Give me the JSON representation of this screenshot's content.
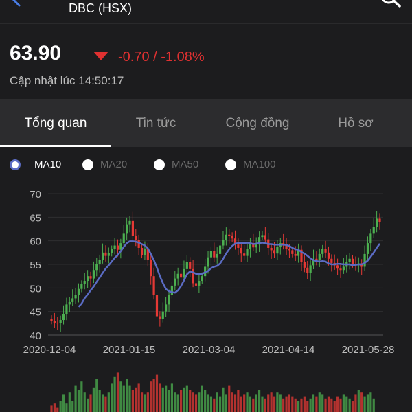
{
  "header": {
    "title": "DBC (HSX)",
    "back_icon": "back-chevron-icon",
    "search_icon": "search-icon"
  },
  "quote": {
    "price": "63.90",
    "change": "-0.70 / -1.08%",
    "updated": "Cập nhật lúc 14:50:17",
    "direction_icon": "triangle-down-icon",
    "down_color": "#e03131"
  },
  "tabs": [
    {
      "label": "Tổng quan",
      "active": true
    },
    {
      "label": "Tin tức",
      "active": false
    },
    {
      "label": "Cộng đồng",
      "active": false
    },
    {
      "label": "Hồ sơ",
      "active": false
    }
  ],
  "legend": [
    {
      "label": "MA10",
      "active": true,
      "color": "#5b6cc4"
    },
    {
      "label": "MA20",
      "active": false
    },
    {
      "label": "MA50",
      "active": false
    },
    {
      "label": "MA100",
      "active": false
    }
  ],
  "chart_data": {
    "type": "candlestick",
    "y_ticks": [
      40,
      45,
      50,
      55,
      60,
      65,
      70
    ],
    "ylim": [
      40,
      70
    ],
    "x_tick_labels": [
      "2020-12-04",
      "2021-01-15",
      "2021-03-04",
      "2021-04-14",
      "2021-05-28"
    ],
    "up_color": "#4caf50",
    "down_color": "#e53935",
    "ma_color": "#5b6cc4",
    "close": [
      43.0,
      42.6,
      42.5,
      43.2,
      44.5,
      46.5,
      47.0,
      47.8,
      48.5,
      49.8,
      50.8,
      51.5,
      52.5,
      52.0,
      53.8,
      55.0,
      56.0,
      57.5,
      56.8,
      57.4,
      58.2,
      59.0,
      58.1,
      59.5,
      61.5,
      63.5,
      64.2,
      61.0,
      60.1,
      58.5,
      57.0,
      58.2,
      56.0,
      52.5,
      48.5,
      44.0,
      43.5,
      45.0,
      46.5,
      48.5,
      50.5,
      52.0,
      53.0,
      52.2,
      54.0,
      55.5,
      54.0,
      51.0,
      50.5,
      51.5,
      52.5,
      54.5,
      56.5,
      57.8,
      56.5,
      57.2,
      59.0,
      60.2,
      61.3,
      61.0,
      60.5,
      59.2,
      58.5,
      57.3,
      56.8,
      58.2,
      59.5,
      58.6,
      59.2,
      60.8,
      61.2,
      60.3,
      58.5,
      58.0,
      57.3,
      58.8,
      59.5,
      59.0,
      58.2,
      58.0,
      57.2,
      56.8,
      58.1,
      55.5,
      54.3,
      53.2,
      54.8,
      56.2,
      56.0,
      57.2,
      58.3,
      57.5,
      56.2,
      55.3,
      54.8,
      54.1,
      53.8,
      54.5,
      55.5,
      56.2,
      55.0,
      54.8,
      55.2,
      54.5,
      57.2,
      59.5,
      61.5,
      63.0,
      64.7,
      63.9
    ],
    "ma10": [
      null,
      null,
      null,
      null,
      null,
      null,
      null,
      null,
      null,
      46.0,
      46.7,
      47.8,
      48.6,
      49.5,
      50.3,
      51.3,
      52.2,
      53.2,
      54.1,
      54.8,
      55.6,
      56.4,
      57.0,
      57.8,
      58.7,
      59.5,
      59.9,
      59.9,
      59.8,
      59.6,
      59.3,
      59.0,
      58.4,
      57.2,
      55.9,
      54.3,
      52.5,
      51.0,
      49.8,
      49.3,
      49.1,
      49.0,
      49.5,
      50.4,
      51.6,
      52.9,
      53.5,
      53.3,
      53.0,
      52.9,
      53.0,
      53.3,
      53.6,
      54.2,
      54.5,
      54.7,
      55.2,
      56.2,
      57.3,
      58.2,
      58.9,
      59.4,
      59.5,
      59.5,
      59.5,
      59.6,
      59.5,
      59.3,
      59.4,
      59.5,
      59.6,
      59.5,
      59.3,
      59.3,
      59.2,
      59.2,
      59.2,
      59.2,
      59.1,
      58.9,
      58.5,
      58.2,
      58.1,
      57.6,
      57.3,
      56.8,
      56.3,
      55.9,
      55.7,
      55.6,
      55.7,
      55.6,
      55.2,
      55.0,
      55.0,
      55.1,
      55.1,
      55.0,
      55.0,
      55.0,
      54.8,
      54.9,
      55.0,
      55.0,
      55.3,
      55.8,
      56.6,
      57.5,
      58.5,
      59.4
    ]
  },
  "volume": {
    "values": [
      3,
      4,
      2,
      5,
      8,
      4,
      9,
      5,
      12,
      10,
      14,
      9,
      6,
      8,
      11,
      15,
      10,
      8,
      7,
      9,
      13,
      16,
      18,
      14,
      12,
      15,
      12,
      10,
      11,
      13,
      9,
      8,
      9,
      14,
      15,
      17,
      13,
      11,
      12,
      10,
      13,
      9,
      8,
      10,
      11,
      12,
      10,
      9,
      8,
      9,
      12,
      10,
      8,
      7,
      6,
      9,
      7,
      11,
      8,
      12,
      9,
      8,
      10,
      7,
      8,
      9,
      7,
      6,
      8,
      10,
      7,
      6,
      8,
      9,
      7,
      9,
      8,
      6,
      7,
      8,
      7,
      6,
      5,
      6,
      7,
      5,
      6,
      8,
      7,
      9,
      8,
      6,
      7,
      6,
      5,
      7,
      6,
      8,
      7,
      6,
      5,
      8,
      10,
      9,
      7,
      8,
      9,
      6
    ],
    "ylim": [
      0,
      70
    ]
  }
}
